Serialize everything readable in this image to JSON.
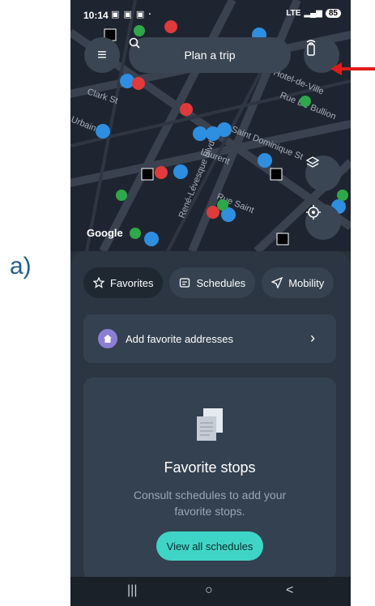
{
  "figure_label": "a)",
  "status_bar": {
    "time": "10:14",
    "signal": "LTE",
    "battery": "85"
  },
  "map": {
    "search_label": "Plan a trip",
    "attribution": "Google",
    "street_labels": [
      "Rue Sa",
      "Rue De Bullion",
      "Saint Dominique St",
      "Clark St",
      "Laurent",
      "René-Lévesque Blvd W",
      "Rue Saint",
      "Hotel-de-Ville",
      "Urbain"
    ]
  },
  "tabs": [
    {
      "label": "Favorites",
      "icon": "star-icon"
    },
    {
      "label": "Schedules",
      "icon": "schedule-icon"
    },
    {
      "label": "Mobility",
      "icon": "navigation-arrow-icon"
    }
  ],
  "add_favorites": {
    "label": "Add favorite addresses"
  },
  "favorite_stops": {
    "title": "Favorite stops",
    "subtitle": "Consult schedules to add your favorite stops.",
    "button": "View all schedules"
  },
  "nav": {
    "recents_icon": "|||",
    "home_icon": "○",
    "back_icon": "<"
  },
  "colors": {
    "accent": "#3fd5c6",
    "home_badge": "#8b7fd4",
    "annotation_arrow": "#e01b1b"
  }
}
